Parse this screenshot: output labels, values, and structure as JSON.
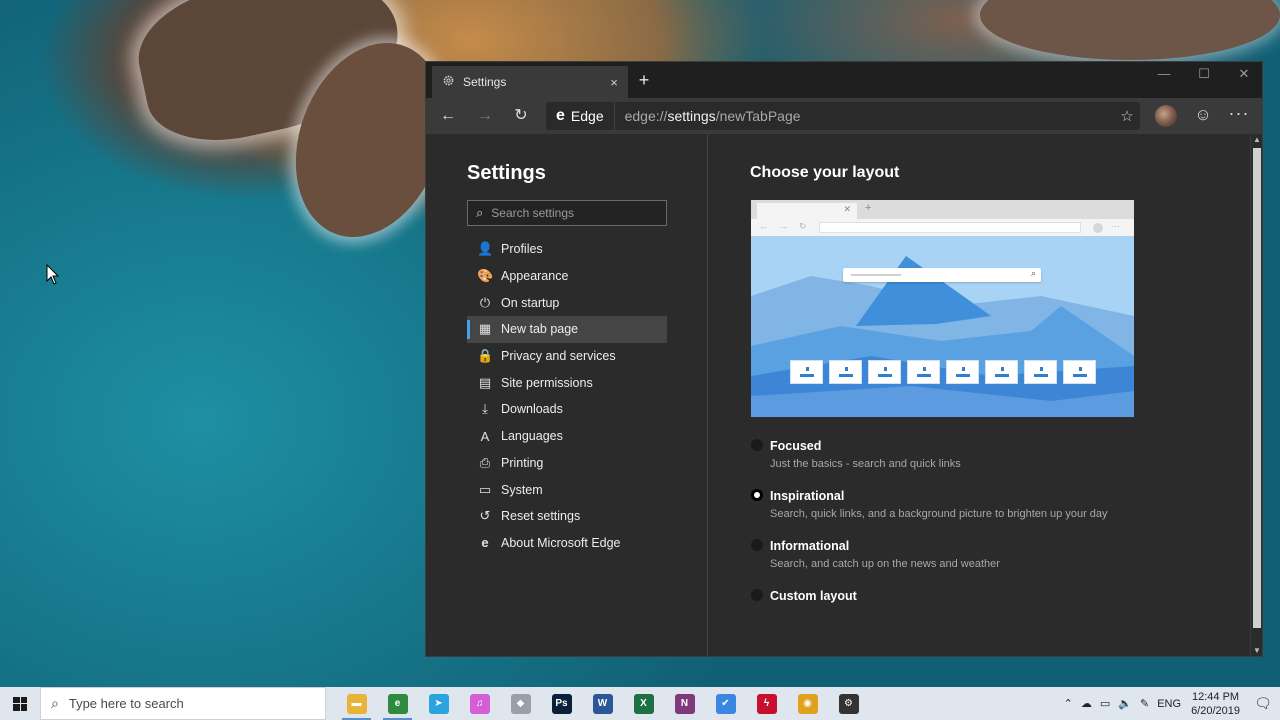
{
  "browser": {
    "tab_title": "Settings",
    "tab_close": "×",
    "new_tab": "+",
    "window_controls": {
      "minimize": "—",
      "maximize": "☐",
      "close": "✕"
    },
    "nav": {
      "back": "←",
      "forward": "→",
      "refresh": "↻"
    },
    "edge_label": "Edge",
    "url_prefix": "edge://",
    "url_bold": "settings",
    "url_suffix": "/newTabPage",
    "favorite_icon": "star-icon",
    "more_label": "···"
  },
  "sidebar": {
    "title": "Settings",
    "search_placeholder": "Search settings",
    "items": [
      {
        "label": "Profiles",
        "icon": "👤"
      },
      {
        "label": "Appearance",
        "icon": "🎨"
      },
      {
        "label": "On startup",
        "icon": "⏻"
      },
      {
        "label": "New tab page",
        "icon": "▦",
        "active": true
      },
      {
        "label": "Privacy and services",
        "icon": "🔒"
      },
      {
        "label": "Site permissions",
        "icon": "▤"
      },
      {
        "label": "Downloads",
        "icon": "⤓"
      },
      {
        "label": "Languages",
        "icon": "A"
      },
      {
        "label": "Printing",
        "icon": "⎙"
      },
      {
        "label": "System",
        "icon": "▭"
      },
      {
        "label": "Reset settings",
        "icon": "↺"
      },
      {
        "label": "About Microsoft Edge",
        "icon": "e"
      }
    ]
  },
  "main": {
    "title": "Choose your layout",
    "options": [
      {
        "label": "Focused",
        "description": "Just the basics - search and quick links",
        "checked": false
      },
      {
        "label": "Inspirational",
        "description": "Search, quick links, and a background picture to brighten up your day",
        "checked": true
      },
      {
        "label": "Informational",
        "description": "Search, and catch up on the news and weather",
        "checked": false
      },
      {
        "label": "Custom layout",
        "description": "",
        "checked": false
      }
    ]
  },
  "taskbar": {
    "search_placeholder": "Type here to search",
    "apps": [
      {
        "name": "file-explorer",
        "glyph": "▬",
        "color": "#e8b33a",
        "running": true
      },
      {
        "name": "edge",
        "glyph": "e",
        "color": "#2d8a3e",
        "running": true
      },
      {
        "name": "telegram",
        "glyph": "➤",
        "color": "#2aa3de",
        "running": false
      },
      {
        "name": "itunes",
        "glyph": "♫",
        "color": "#d35fd8",
        "running": false
      },
      {
        "name": "app-grey",
        "glyph": "◆",
        "color": "#9aa0a6",
        "running": false
      },
      {
        "name": "photoshop",
        "glyph": "Ps",
        "color": "#0a1f3a",
        "running": false
      },
      {
        "name": "word",
        "glyph": "W",
        "color": "#2b5797",
        "running": false
      },
      {
        "name": "excel",
        "glyph": "X",
        "color": "#1e7145",
        "running": false
      },
      {
        "name": "onenote",
        "glyph": "N",
        "color": "#80397b",
        "running": false
      },
      {
        "name": "todo",
        "glyph": "✔",
        "color": "#3a86e0",
        "running": false
      },
      {
        "name": "flash",
        "glyph": "ϟ",
        "color": "#c8102e",
        "running": false
      },
      {
        "name": "app-globe",
        "glyph": "◉",
        "color": "#e0a21e",
        "running": false
      },
      {
        "name": "settings",
        "glyph": "⚙",
        "color": "#333333",
        "running": false
      }
    ],
    "tray": {
      "language": "ENG",
      "time": "12:44 PM",
      "date": "6/20/2019"
    }
  },
  "colors": {
    "accent": "#4aa0e6",
    "window_bg": "#2b2b2b"
  }
}
